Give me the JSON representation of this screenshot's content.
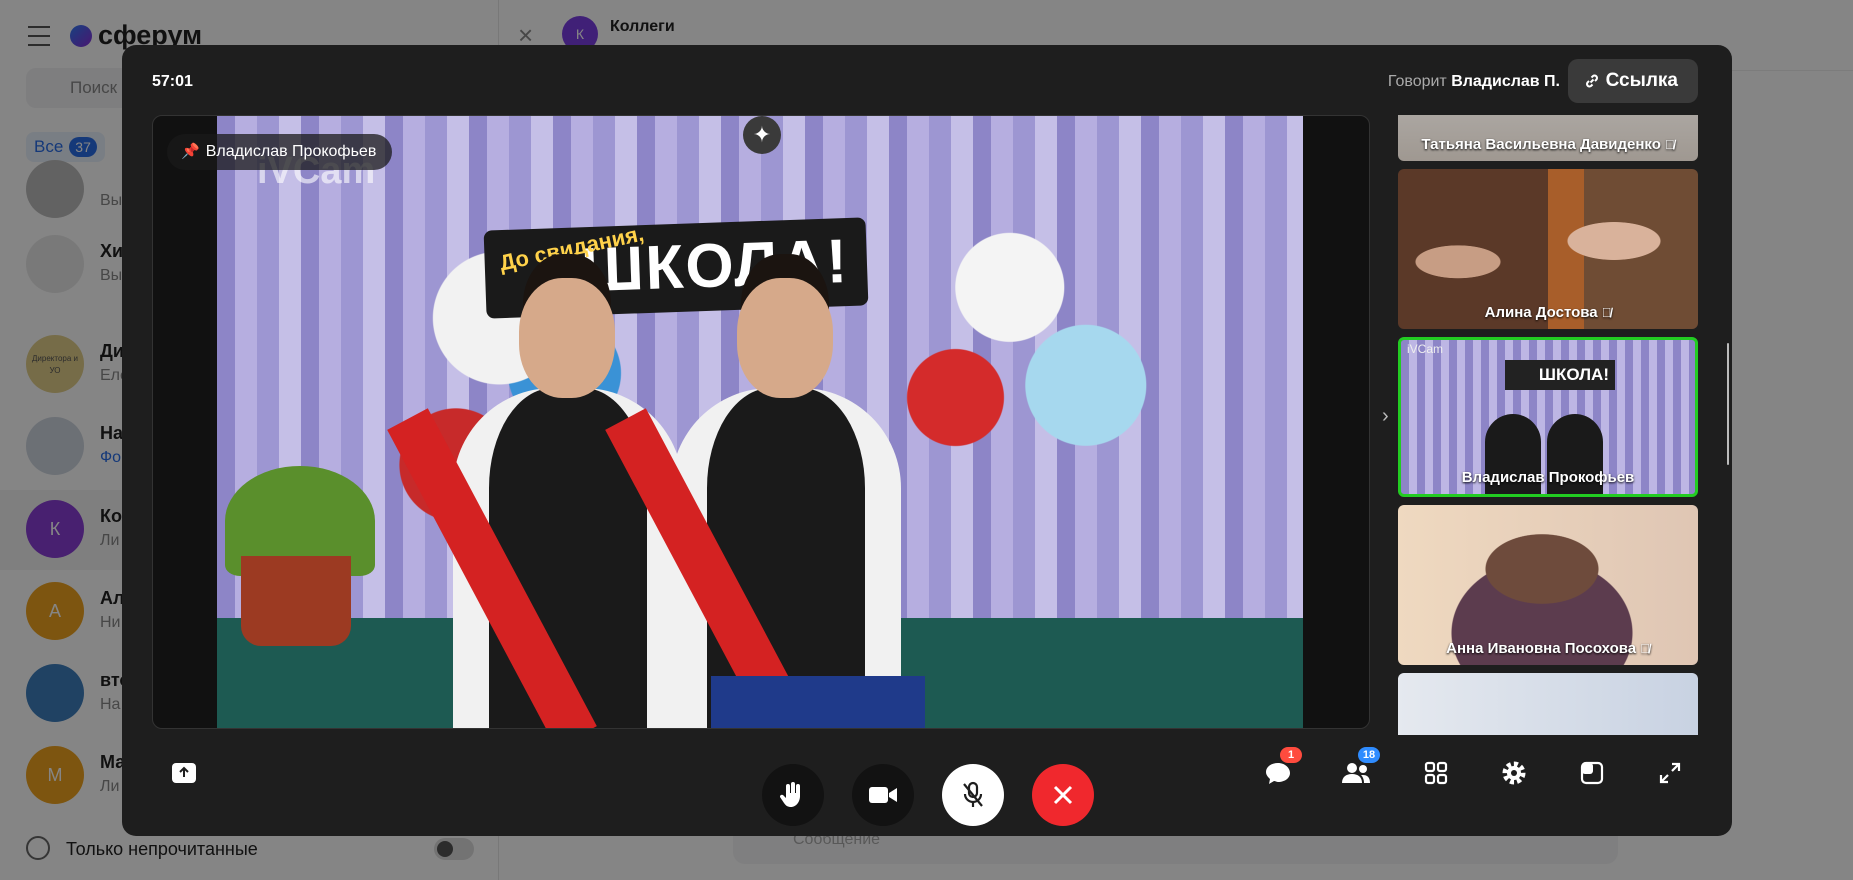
{
  "app": {
    "logo": "сферум",
    "search_placeholder": "Поиск",
    "filter": {
      "label": "Все",
      "count": "37"
    },
    "chats": [
      {
        "name": "",
        "preview": "Вы",
        "avatar": "",
        "color": "#bdbdbd"
      },
      {
        "name": "Хи",
        "preview": "Вы",
        "avatar": "",
        "color": "#e8e8e8"
      },
      {
        "name": "Ди",
        "preview": "Еле",
        "avatar": "Директора и УО",
        "color": "#e3cf8a"
      },
      {
        "name": "На",
        "preview": "Фо",
        "avatar": "",
        "color": "#cfd6e1"
      },
      {
        "name": "Ко",
        "preview": "Ли",
        "avatar": "К",
        "color": "#8a3ed6"
      },
      {
        "name": "Ал",
        "preview": "Ни",
        "avatar": "А",
        "color": "#f0a41f"
      },
      {
        "name": "вто",
        "preview": "На",
        "avatar": "",
        "color": "#3f7fbf"
      },
      {
        "name": "Ма",
        "preview": "Ли",
        "avatar": "М",
        "color": "#f0a41f"
      }
    ],
    "only_unread": "Только непрочитанные",
    "chat_header": {
      "title": "Коллеги",
      "avatar": "К"
    },
    "message_placeholder": "Сообщение"
  },
  "call": {
    "timer": "57:01",
    "speaking_label": "Говорит",
    "speaking_name": "Владислав П.",
    "link_button": "Ссылка",
    "pinned_name": "Владислав Прокофьев",
    "video_watermark": "iVCam",
    "video_banner_small": "До свидания,",
    "video_banner_text": "ШКОЛА!",
    "participants": [
      {
        "name": "Татьяна Васильевна Давиденко",
        "muted": true
      },
      {
        "name": "Алина Достова",
        "muted": true
      },
      {
        "name": "Владислав Прокофьев",
        "muted": false,
        "active": true
      },
      {
        "name": "Анна Ивановна Посохова",
        "muted": true
      },
      {
        "name": "",
        "muted": false
      }
    ],
    "controls": {
      "chat_badge": "1",
      "participants_badge": "18"
    },
    "colors": {
      "active_border": "#22cc22",
      "end_call": "#f0282d",
      "badge_chat": "#ff4b3e",
      "badge_people": "#2f8cff"
    }
  }
}
